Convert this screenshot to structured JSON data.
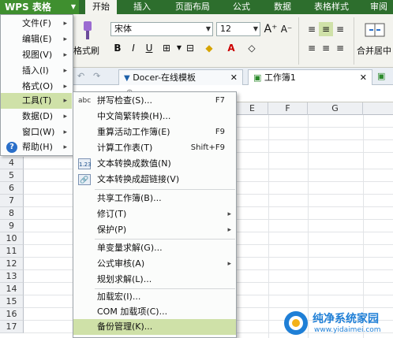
{
  "app": {
    "name": "WPS 表格"
  },
  "ribbon_tabs": [
    "开始",
    "插入",
    "页面布局",
    "公式",
    "数据",
    "表格样式",
    "审阅"
  ],
  "ribbon": {
    "format_painter": "格式刷",
    "font_name": "宋体",
    "font_size": "12",
    "merge_center": "合并居中",
    "bold": "B",
    "italic": "I",
    "underline": "U",
    "font_color_glyph": "A",
    "grow_font": "A⁺",
    "shrink_font": "A⁻"
  },
  "doc_tabs": [
    {
      "label": "Docer-在线模板"
    },
    {
      "label": "工作簿1"
    }
  ],
  "grid": {
    "columns": [
      "E",
      "F",
      "G"
    ],
    "rows": [
      "4",
      "5",
      "6",
      "7",
      "8",
      "9",
      "10",
      "11",
      "12",
      "13",
      "14",
      "15",
      "16",
      "17"
    ]
  },
  "left_menu": {
    "items": [
      {
        "label": "文件(F)"
      },
      {
        "label": "编辑(E)"
      },
      {
        "label": "视图(V)"
      },
      {
        "label": "插入(I)"
      },
      {
        "label": "格式(O)"
      },
      {
        "label": "工具(T)"
      },
      {
        "label": "数据(D)"
      },
      {
        "label": "窗口(W)"
      },
      {
        "label": "帮助(H)"
      }
    ]
  },
  "tools_menu": {
    "items": [
      {
        "label": "拼写检查(S)...",
        "shortcut": "F7",
        "icon": "abc"
      },
      {
        "label": "中文简繁转换(H)..."
      },
      {
        "label": "重算活动工作簿(E)",
        "shortcut": "F9"
      },
      {
        "label": "计算工作表(T)",
        "shortcut": "Shift+F9"
      },
      {
        "label": "文本转换成数值(N)",
        "icon": "1.23"
      },
      {
        "label": "文本转换成超链接(V)",
        "icon": "link"
      },
      {
        "label": "共享工作簿(B)..."
      },
      {
        "label": "修订(T)"
      },
      {
        "label": "保护(P)"
      },
      {
        "label": "单变量求解(G)..."
      },
      {
        "label": "公式审核(A)"
      },
      {
        "label": "规划求解(L)..."
      },
      {
        "label": "加载宏(I)..."
      },
      {
        "label": "COM 加载项(C)..."
      },
      {
        "label": "备份管理(K)..."
      }
    ]
  },
  "watermark": {
    "title": "纯净系统家园",
    "url": "www.yidaimei.com"
  },
  "colors": {
    "title_green": "#2d6e2d",
    "menu_highlight": "#cfe1a8"
  }
}
